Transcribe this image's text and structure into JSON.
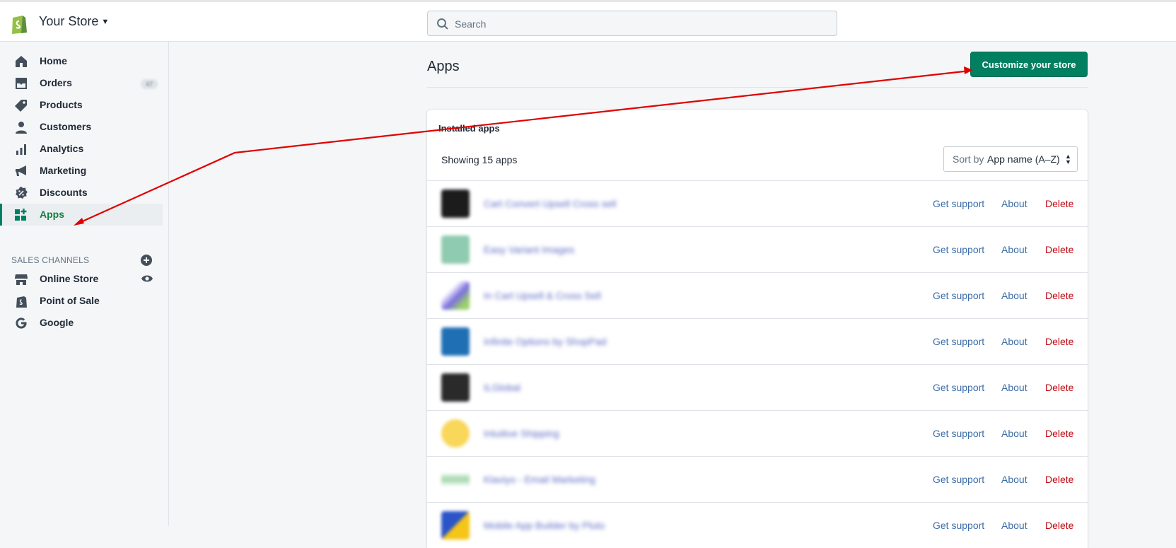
{
  "topbar": {
    "store_name": "Your Store",
    "search_placeholder": "Search"
  },
  "sidebar": {
    "items": [
      {
        "label": "Home",
        "icon": "home-icon"
      },
      {
        "label": "Orders",
        "icon": "orders-icon",
        "badge": "47"
      },
      {
        "label": "Products",
        "icon": "tag-icon"
      },
      {
        "label": "Customers",
        "icon": "person-icon"
      },
      {
        "label": "Analytics",
        "icon": "bar-chart-icon"
      },
      {
        "label": "Marketing",
        "icon": "megaphone-icon"
      },
      {
        "label": "Discounts",
        "icon": "discount-icon"
      },
      {
        "label": "Apps",
        "icon": "apps-icon",
        "active": true
      }
    ],
    "sales_channels_title": "SALES CHANNELS",
    "channels": [
      {
        "label": "Online Store",
        "icon": "store-icon"
      },
      {
        "label": "Point of Sale",
        "icon": "pos-bag-icon"
      },
      {
        "label": "Google",
        "icon": "google-icon"
      }
    ]
  },
  "main": {
    "title": "Apps",
    "primary_button": "Customize your store",
    "card_title": "Installed apps",
    "showing": "Showing 15 apps",
    "sort_label": "Sort by",
    "sort_value": "App name (A–Z)",
    "actions": {
      "support": "Get support",
      "about": "About",
      "delete": "Delete"
    },
    "apps": [
      {
        "name": "Cart Convert Upsell Cross sell",
        "icon_color": "#1c1c1c"
      },
      {
        "name": "Easy Variant Images",
        "icon_color": "#8fcbb0"
      },
      {
        "name": "In Cart Upsell & Cross Sell",
        "icon_color": "#7b6ee0"
      },
      {
        "name": "Infinite Options by ShopPad",
        "icon_color": "#1f6fb5"
      },
      {
        "name": "ILGlobal",
        "icon_color": "#2a2a2a"
      },
      {
        "name": "Intuitive Shipping",
        "icon_color": "#f8d75a"
      },
      {
        "name": "Klaviyo - Email Marketing",
        "icon_color": "#9fd3a8"
      },
      {
        "name": "Mobile App Builder by Pluto",
        "icon_color": "#2b54c8"
      }
    ]
  },
  "colors": {
    "accent": "#008060",
    "link": "#3d6ea8",
    "delete": "#bf0711",
    "arrow": "#e00000"
  }
}
